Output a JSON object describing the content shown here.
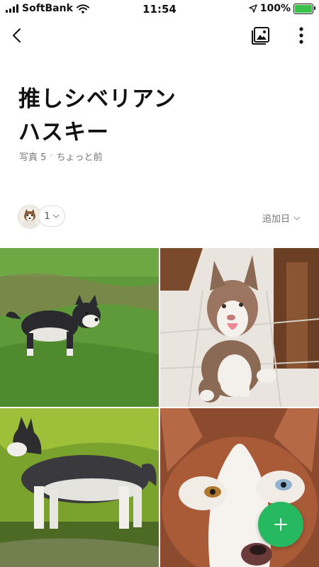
{
  "status_bar": {
    "carrier": "SoftBank",
    "time": "11:54",
    "battery_percent": "100%"
  },
  "nav": {
    "back_icon": "chevron-left-icon",
    "album_icon": "photo-album-icon",
    "more_icon": "more-vertical-icon"
  },
  "album": {
    "title_line1": "推しシベリアン",
    "title_line2": "ハスキー",
    "photo_label": "写真 5",
    "separator": "·",
    "updated": "ちょっと前"
  },
  "members": {
    "count": "1"
  },
  "sort": {
    "label": "追加日"
  },
  "photos": [
    {
      "alt": "Black and white husky puppy on grass"
    },
    {
      "alt": "Brown husky puppy sitting on tiled floor"
    },
    {
      "alt": "Black and white husky standing on grass"
    },
    {
      "alt": "Brown and white husky face close-up"
    }
  ],
  "fab": {
    "icon": "plus-icon"
  },
  "colors": {
    "accent": "#27b95f",
    "battery": "#38c24a"
  }
}
